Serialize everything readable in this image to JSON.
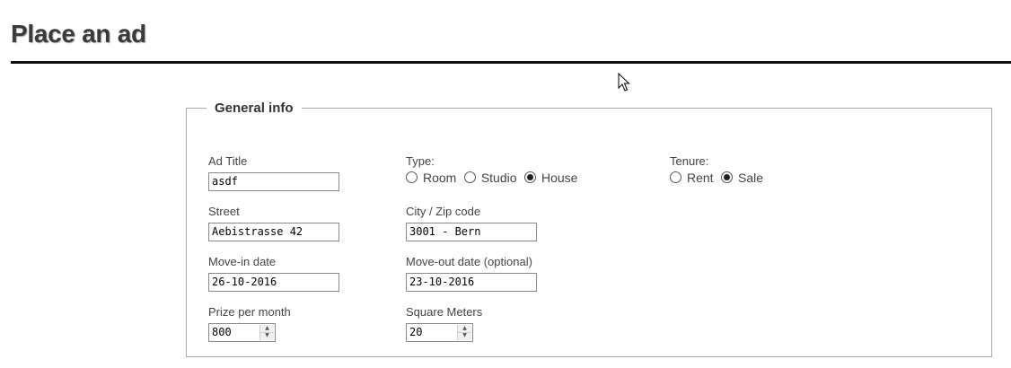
{
  "page": {
    "title": "Place an ad"
  },
  "general_info": {
    "legend": "General info",
    "ad_title": {
      "label": "Ad Title",
      "value": "asdf"
    },
    "type": {
      "label": "Type:",
      "options": [
        {
          "label": "Room",
          "checked": false
        },
        {
          "label": "Studio",
          "checked": false
        },
        {
          "label": "House",
          "checked": true
        }
      ]
    },
    "tenure": {
      "label": "Tenure:",
      "options": [
        {
          "label": "Rent",
          "checked": false
        },
        {
          "label": "Sale",
          "checked": true
        }
      ]
    },
    "street": {
      "label": "Street",
      "value": "Aebistrasse 42"
    },
    "city_zip": {
      "label": "City / Zip code",
      "value": "3001 - Bern"
    },
    "move_in": {
      "label": "Move-in date",
      "value": "26-10-2016"
    },
    "move_out": {
      "label": "Move-out date (optional)",
      "value": "23-10-2016"
    },
    "prize": {
      "label": "Prize per month",
      "value": "800"
    },
    "square_meters": {
      "label": "Square Meters",
      "value": "20"
    }
  }
}
